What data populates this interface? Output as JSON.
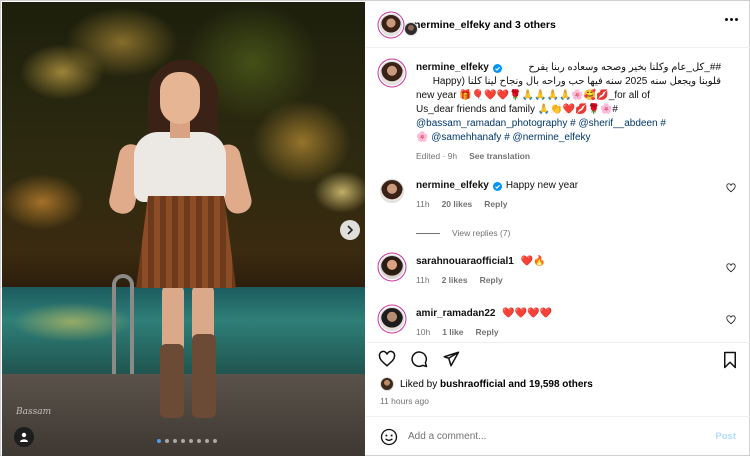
{
  "post": {
    "author": "nermine_elfeky",
    "coauthors": "and 3 others",
    "photo_signature": "Bassam",
    "carousel": {
      "count": 8,
      "active_index": 0
    }
  },
  "caption": {
    "username": "nermine_elfeky",
    "line1": "##_كل_عام وكلنا بخير وصحه وسعاده ربنا يفرح",
    "line2": "قلوبنا ويجعل سنه 2025 سنه فيها حب وراحه بال ونجاح لينا كلنا (Happy",
    "line3": "new year 🎁🎈❤️❤️🌹🙏🙏🙏🙏🌸🥰💋_for all of",
    "line4": "Us_dear friends and family 🙏👏❤️💋🌹🌸#",
    "line5": "@bassam_ramadan_photography # @sherif__abdeen #",
    "line6": "🌸 @samehhanafy # @nermine_elfeky",
    "edited": "Edited · 9h",
    "translate": "See translation"
  },
  "comments": [
    {
      "username": "nermine_elfeky",
      "text": "Happy new year",
      "time": "11h",
      "likes": "20 likes",
      "reply": "Reply"
    },
    {
      "username": "sarahnouaraofficial1",
      "text": "❤️🔥",
      "time": "11h",
      "likes": "2 likes",
      "reply": "Reply"
    },
    {
      "username": "amir_ramadan22",
      "text": "❤️❤️❤️❤️",
      "time": "10h",
      "likes": "1 like",
      "reply": "Reply"
    }
  ],
  "view_replies": "View replies (7)",
  "likes": {
    "prefix": "Liked by",
    "user": "bushraofficial",
    "suffix": "and 19,598 others"
  },
  "time_ago": "11 hours ago",
  "add_comment": {
    "placeholder": "Add a comment...",
    "post_label": "Post"
  },
  "icons": [
    "more-icon",
    "verified-icon",
    "heart-icon",
    "comment-icon",
    "share-icon",
    "bookmark-icon",
    "emoji-icon",
    "chevron-right-icon",
    "user-tag-icon"
  ],
  "colors": {
    "link": "#00376b",
    "verified": "#0095f6",
    "muted": "#737373",
    "post_disabled": "#b3dbff"
  }
}
